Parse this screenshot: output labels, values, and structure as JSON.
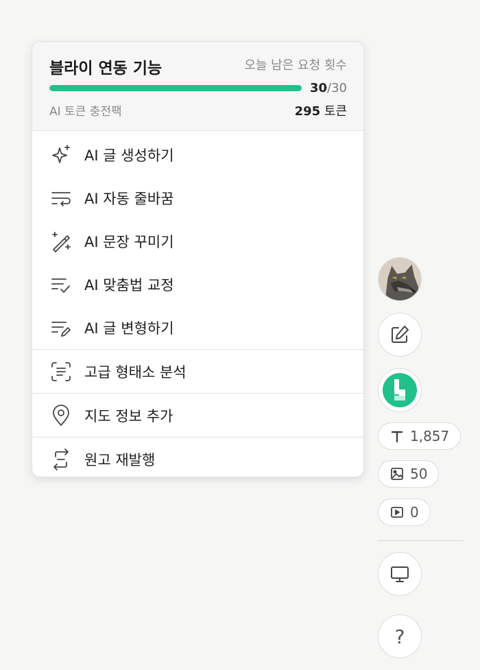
{
  "popup": {
    "title": "블라이 연동 기능",
    "remaining_label": "오늘 남은 요청 횟수",
    "usage": {
      "used": "30",
      "separator": "/",
      "total": "30",
      "fraction": 1.0
    },
    "token_pack_label": "AI 토큰 충전팩",
    "token_count": "295",
    "token_unit": " 토큰",
    "items": [
      {
        "label": "AI 글 생성하기",
        "icon": "sparkle-icon"
      },
      {
        "label": "AI 자동 줄바꿈",
        "icon": "line-wrap-icon"
      },
      {
        "label": "AI 문장 꾸미기",
        "icon": "magic-wand-icon"
      },
      {
        "label": "AI 맞춤법 교정",
        "icon": "list-check-icon"
      },
      {
        "label": "AI 글 변형하기",
        "icon": "list-edit-icon"
      },
      {
        "label": "고급 형태소 분석",
        "icon": "scan-text-icon"
      },
      {
        "label": "지도 정보 추가",
        "icon": "map-pin-icon"
      },
      {
        "label": "원고 재발행",
        "icon": "republish-icon"
      }
    ]
  },
  "sidebar": {
    "char_count": "1,857",
    "image_count": "50",
    "video_count": "0",
    "help_label": "?",
    "accent": "#22c08a"
  }
}
